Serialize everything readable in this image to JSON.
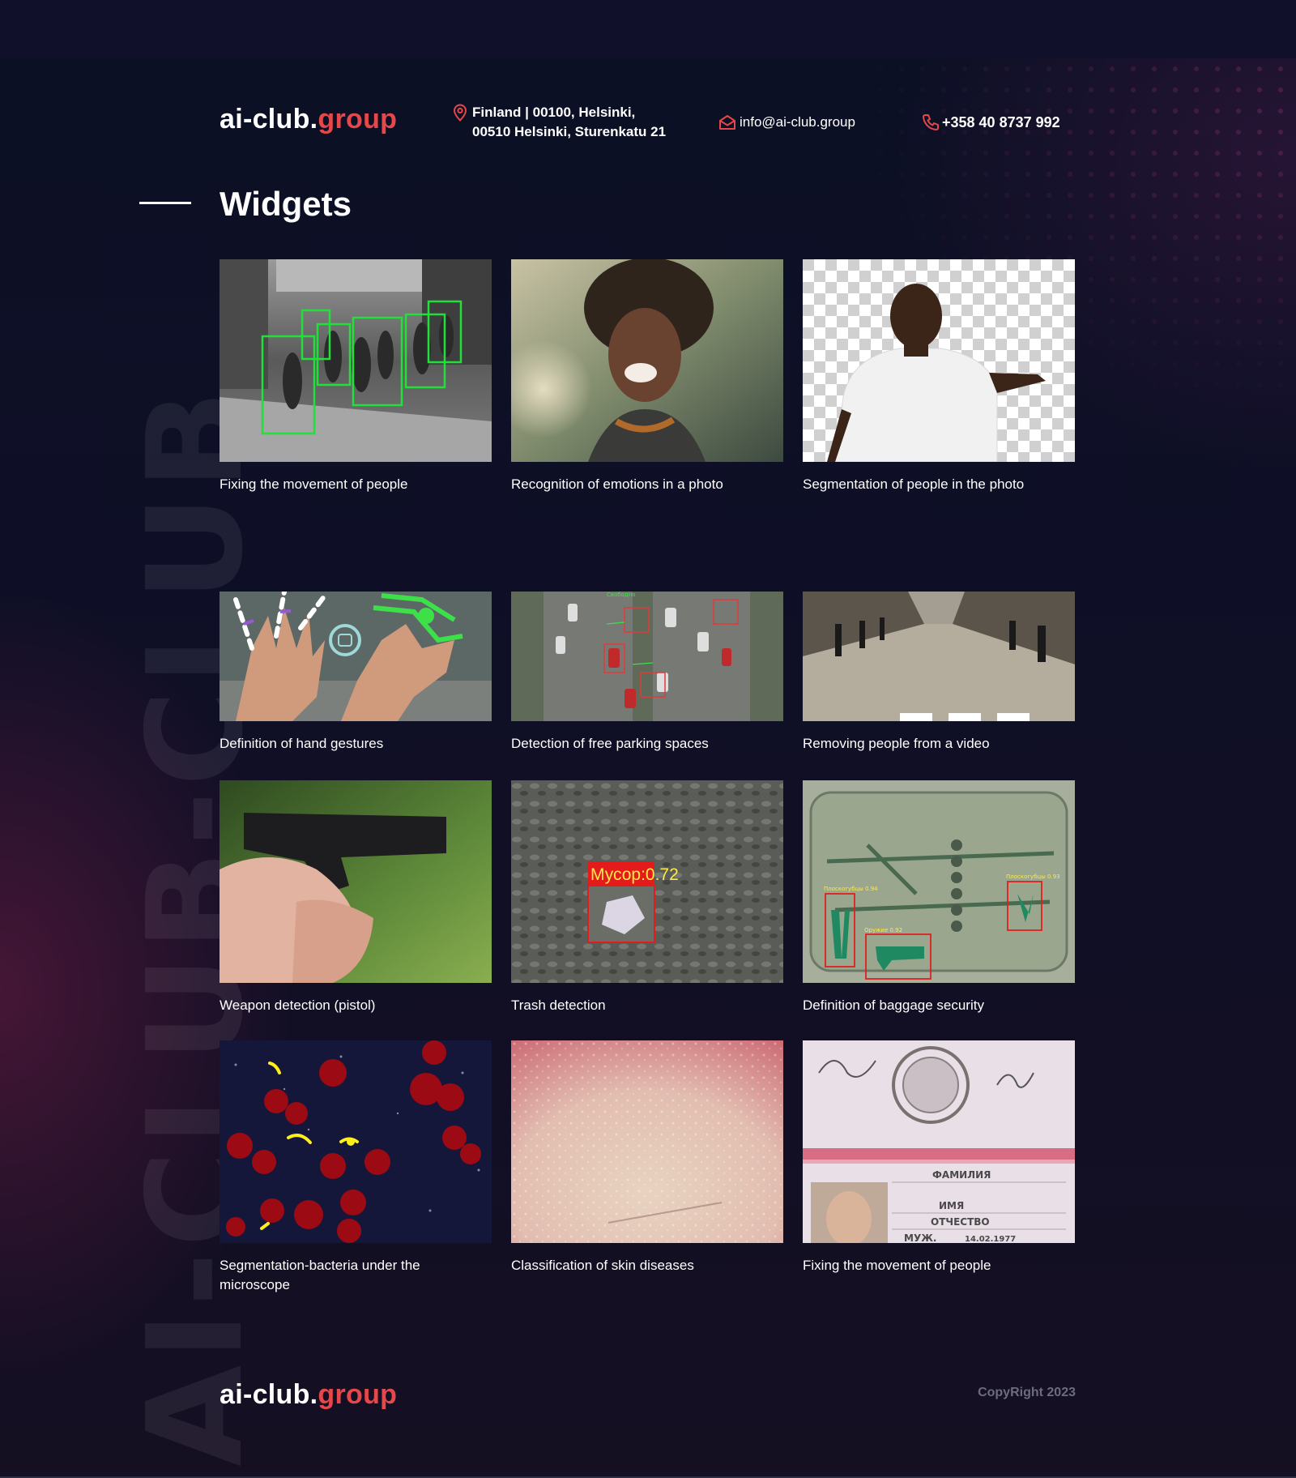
{
  "header": {
    "logo": {
      "text": "ai-club.",
      "accent": "group"
    },
    "address": {
      "line1": "Finland | 00100, Helsinki,",
      "line2": "00510 Helsinki, Sturenkatu 21",
      "icon": "location-pin-icon"
    },
    "email": {
      "text": "info@ai-club.group",
      "icon": "envelope-icon"
    },
    "phone": {
      "text": "+358 40 8737 992",
      "icon": "phone-icon"
    }
  },
  "decor": {
    "vertical_brand": "AI-CLUB-CLUB"
  },
  "section": {
    "title": "Widgets"
  },
  "widgets": [
    {
      "caption": "Fixing the movement of people"
    },
    {
      "caption": "Recognition of emotions in a photo"
    },
    {
      "caption": "Segmentation of people in the photo"
    },
    {
      "caption": "Definition of hand gestures"
    },
    {
      "caption": "Detection of free parking spaces"
    },
    {
      "caption": "Removing people from a video"
    },
    {
      "caption": "Weapon detection (pistol)"
    },
    {
      "caption": "Trash detection",
      "detection_label": "Мусор:0.72"
    },
    {
      "caption": "Definition of baggage security",
      "detection_labels": [
        "Плоскогубцы 0.94",
        "Плоскогубцы 0.93",
        "Оружие 0.92"
      ]
    },
    {
      "caption": "Segmentation-bacteria under the microscope"
    },
    {
      "caption": "Classification of skin diseases"
    },
    {
      "caption": "Fixing the movement of people",
      "document_fields": [
        "ФАМИЛИЯ",
        "ИМЯ",
        "ОТЧЕСТВО",
        "МУЖ.",
        "14.02.1977"
      ]
    }
  ],
  "footer": {
    "logo": {
      "text": "ai-club.",
      "accent": "group"
    },
    "copyright": "CopyRight 2023"
  },
  "colors": {
    "background": "#0e0f22",
    "accent": "#e5474a",
    "text": "#ffffff",
    "muted": "#6c6c7c"
  }
}
